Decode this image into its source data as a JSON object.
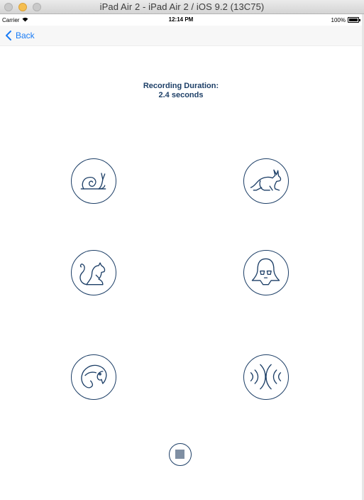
{
  "window": {
    "title": "iPad Air 2 - iPad Air 2 / iOS 9.2 (13C75)"
  },
  "status_bar": {
    "carrier": "Carrier",
    "time": "12:14 PM",
    "battery": "100%"
  },
  "nav": {
    "back_label": "Back"
  },
  "recording": {
    "label": "Recording Duration:",
    "value": "2.4 seconds"
  },
  "effects": [
    {
      "icon": "snail-icon"
    },
    {
      "icon": "rabbit-icon"
    },
    {
      "icon": "squirrel-icon"
    },
    {
      "icon": "darth-vader-icon"
    },
    {
      "icon": "parrot-icon"
    },
    {
      "icon": "echo-icon"
    }
  ],
  "colors": {
    "primary": "#1d3f67",
    "link": "#1a7cf5",
    "stop_fill": "#7f8fa3"
  }
}
